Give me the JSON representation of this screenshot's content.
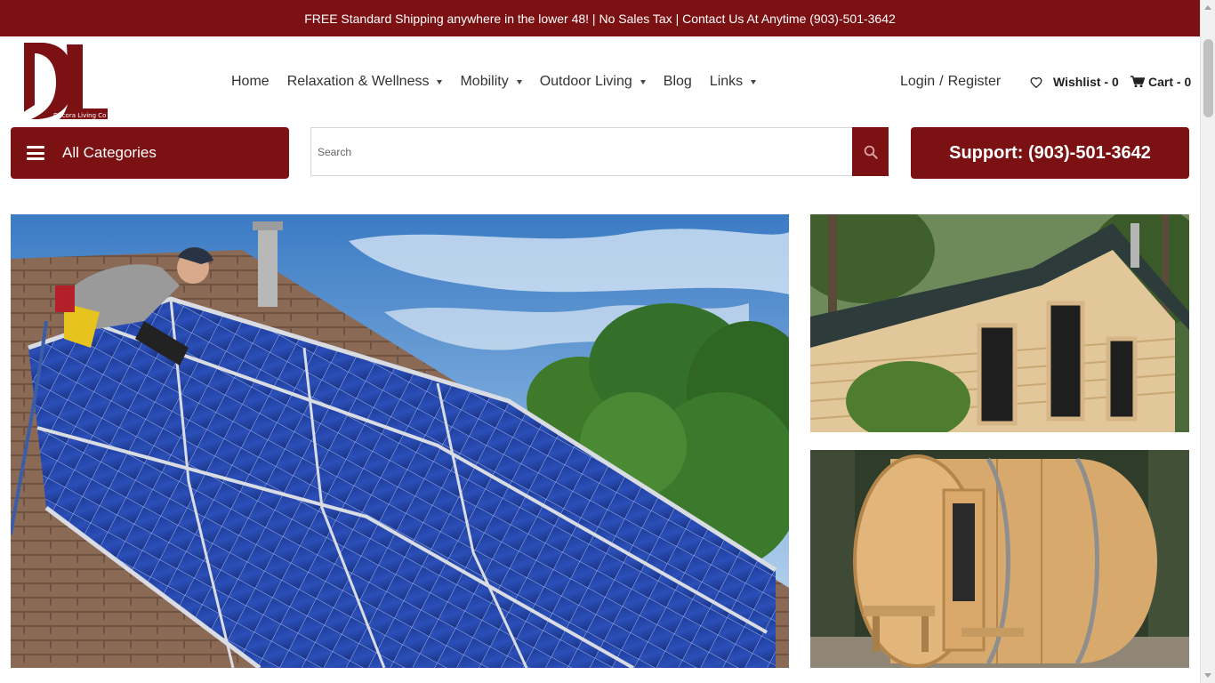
{
  "topbar": {
    "message": "FREE Standard Shipping anywhere in the lower 48! | No Sales Tax | Contact Us At Anytime (903)-501-3642"
  },
  "logo": {
    "letters": "DL",
    "caption": "Decora Living Co"
  },
  "nav": {
    "items": [
      {
        "label": "Home",
        "dropdown": false
      },
      {
        "label": "Relaxation & Wellness",
        "dropdown": true
      },
      {
        "label": "Mobility",
        "dropdown": true
      },
      {
        "label": "Outdoor Living",
        "dropdown": true
      },
      {
        "label": "Blog",
        "dropdown": false
      },
      {
        "label": "Links",
        "dropdown": true
      }
    ]
  },
  "account": {
    "login": "Login",
    "separator": "/",
    "register": "Register"
  },
  "wishlist": {
    "label": "Wishlist - 0",
    "icon": "heart-icon"
  },
  "cart": {
    "label": "Cart - 0",
    "icon": "cart-icon"
  },
  "categories": {
    "label": "All Categories",
    "icon": "hamburger-icon"
  },
  "search": {
    "placeholder": "Search",
    "value": "",
    "icon": "search-icon"
  },
  "support": {
    "label": "Support: (903)-501-3642"
  },
  "banners": [
    {
      "subject": "rooftop solar panel installation photo"
    },
    {
      "subject": "cedar cabin sauna photo"
    },
    {
      "subject": "barrel sauna photo"
    }
  ],
  "colors": {
    "brand": "#7b1113",
    "text": "#333333",
    "white": "#ffffff"
  }
}
